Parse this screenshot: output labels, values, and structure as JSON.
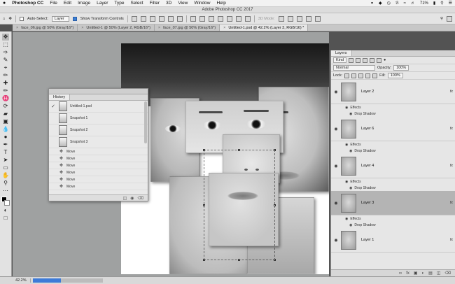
{
  "menubar": {
    "apple": "",
    "app": "Photoshop CC",
    "items": [
      "File",
      "Edit",
      "Image",
      "Layer",
      "Type",
      "Select",
      "Filter",
      "3D",
      "View",
      "Window",
      "Help"
    ],
    "battery": "71%"
  },
  "window": {
    "title": "Adobe Photoshop CC 2017"
  },
  "options": {
    "auto_select_label": "Auto-Select:",
    "auto_select_value": "Layer",
    "show_transform_label": "Show Transform Controls",
    "mode_3d": "3D Mode:"
  },
  "tabs": [
    {
      "label": "face_06.jpg @ 50% (Gray/16*)"
    },
    {
      "label": "Untitled-1 @ 50% (Layer 2, RGB/16*)"
    },
    {
      "label": "face_07.jpg @ 50% (Gray/16*)"
    },
    {
      "label": "Untitled-1.psd @ 42.2% (Layer 3, RGB/16) *"
    }
  ],
  "tools": [
    "move",
    "marquee",
    "lasso",
    "quick-select",
    "crop",
    "eyedropper",
    "healing",
    "brush",
    "clone",
    "history-brush",
    "eraser",
    "gradient",
    "blur",
    "dodge",
    "pen",
    "type",
    "path-select",
    "shape",
    "hand",
    "zoom",
    "more"
  ],
  "history": {
    "tab": "History",
    "source": "Untitled-1.psd",
    "snapshots": [
      "Snapshot 1",
      "Snapshot 2",
      "Snapshot 3"
    ],
    "steps": [
      "Move",
      "Move",
      "Move",
      "Move",
      "Move",
      "Move"
    ]
  },
  "layers": {
    "tab": "Layers",
    "kind": "Kind",
    "blend": "Normal",
    "opacity_label": "Opacity:",
    "opacity_value": "100%",
    "lock_label": "Lock:",
    "fill_label": "Fill:",
    "fill_value": "100%",
    "effects_label": "Effects",
    "drop_shadow_label": "Drop Shadow",
    "fx": "fx",
    "items": [
      {
        "name": "Layer 2"
      },
      {
        "name": "Layer 6"
      },
      {
        "name": "Layer 4"
      },
      {
        "name": "Layer 3",
        "selected": true
      },
      {
        "name": "Layer 1"
      }
    ]
  },
  "status": {
    "zoom": "42.2%",
    "progress": 0.4
  },
  "colors": {
    "selection": "#b4b4b4",
    "accent": "#3d7bd8"
  }
}
